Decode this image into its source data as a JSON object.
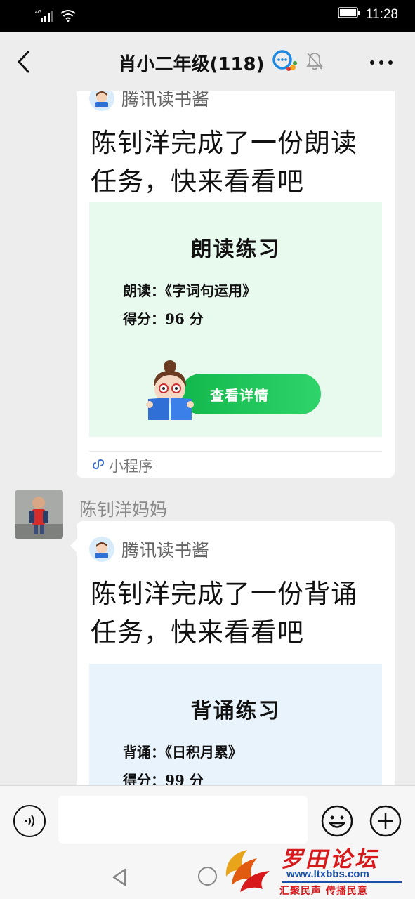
{
  "status_bar": {
    "signal_label": "4G",
    "time": "11:28"
  },
  "nav": {
    "title": "肖小二年级(118)"
  },
  "messages": [
    {
      "source_name": "腾讯读书酱",
      "text_line1": "陈钊洋完成了一份朗读",
      "text_line2": "任务，快来看看吧",
      "preview": {
        "title": "朗读练习",
        "line1": "朗读：《字词句运用》",
        "line2": "得分：96 分",
        "button": "查看详情"
      },
      "footer": "小程序"
    },
    {
      "sender": "陈钊洋妈妈",
      "source_name": "腾讯读书酱",
      "text_line1": "陈钊洋完成了一份背诵",
      "text_line2": "任务，快来看看吧",
      "preview": {
        "title": "背诵练习",
        "line1": "背诵：《日积月累》",
        "line2": "得分：99 分"
      }
    }
  ],
  "watermark": {
    "title": "罗田论坛",
    "url": "www.ltxbbs.com",
    "slogan": "汇聚民声 传播民意"
  },
  "colors": {
    "accent_green": "#1ec05a",
    "bg": "#ededed",
    "watermark_red": "#d8191b"
  }
}
